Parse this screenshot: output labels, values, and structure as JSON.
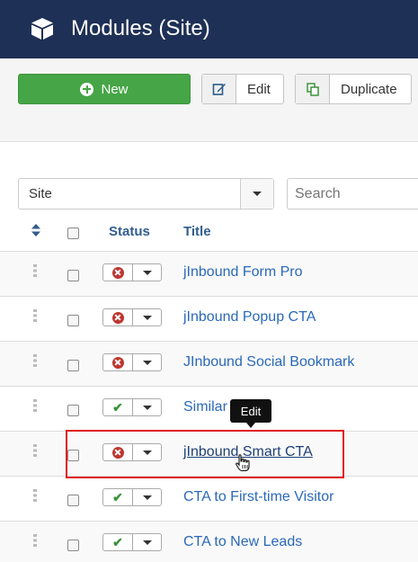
{
  "header": {
    "title": "Modules (Site)",
    "icon": "cube-icon"
  },
  "toolbar": {
    "new_label": "New",
    "edit_label": "Edit",
    "duplicate_label": "Duplicate"
  },
  "filters": {
    "client_value": "Site",
    "search_placeholder": "Search"
  },
  "table": {
    "headers": {
      "status": "Status",
      "title": "Title"
    },
    "rows": [
      {
        "status": "unpublished",
        "title": "jInbound Form Pro"
      },
      {
        "status": "unpublished",
        "title": "jInbound Popup CTA"
      },
      {
        "status": "unpublished",
        "title": "JInbound Social Bookmark"
      },
      {
        "status": "published",
        "title": "Similar Items"
      },
      {
        "status": "unpublished",
        "title": "jInbound Smart CTA"
      },
      {
        "status": "published",
        "title": "CTA to First-time Visitor"
      },
      {
        "status": "published",
        "title": "CTA to New Leads"
      }
    ]
  },
  "tooltip": {
    "text": "Edit"
  },
  "colors": {
    "header_bg": "#1e3055",
    "new_button": "#46a546",
    "link": "#2a69b8",
    "unpublished": "#bd362f",
    "published": "#3c923c",
    "highlight": "#e0191a"
  }
}
